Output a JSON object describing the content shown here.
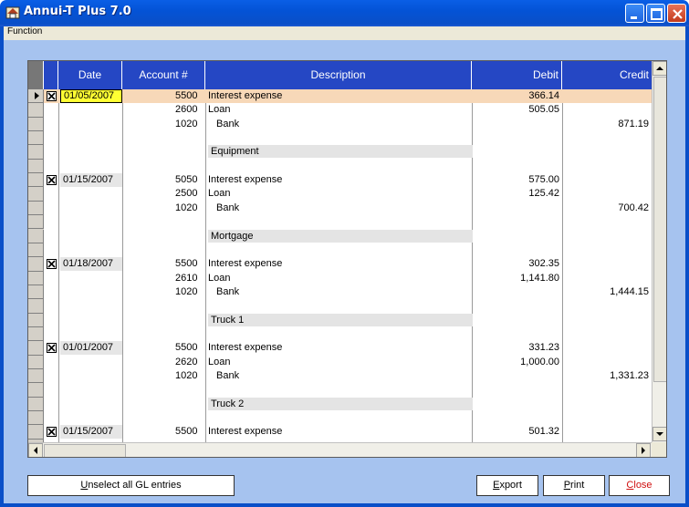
{
  "window": {
    "title": "Annui-T Plus 7.0"
  },
  "menu": {
    "function_label": "Function"
  },
  "columns": {
    "date": "Date",
    "account": "Account #",
    "description": "Description",
    "debit": "Debit",
    "credit": "Credit"
  },
  "rows": [
    {
      "checked": true,
      "date": "01/05/2007",
      "account": "5500",
      "description": "Interest expense",
      "debit": "366.14",
      "credit": "",
      "selected": true
    },
    {
      "account": "2600",
      "description": "Loan",
      "debit": "505.05",
      "credit": ""
    },
    {
      "account": "1020",
      "description": "Bank",
      "indent": true,
      "debit": "",
      "credit": "871.19"
    },
    {},
    {
      "category": "Equipment"
    },
    {},
    {
      "checked": true,
      "date": "01/15/2007",
      "account": "5050",
      "description": "Interest expense",
      "debit": "575.00",
      "credit": ""
    },
    {
      "account": "2500",
      "description": "Loan",
      "debit": "125.42",
      "credit": ""
    },
    {
      "account": "1020",
      "description": "Bank",
      "indent": true,
      "debit": "",
      "credit": "700.42"
    },
    {},
    {
      "category": "Mortgage"
    },
    {},
    {
      "checked": true,
      "date": "01/18/2007",
      "account": "5500",
      "description": "Interest expense",
      "debit": "302.35",
      "credit": ""
    },
    {
      "account": "2610",
      "description": "Loan",
      "debit": "1,141.80",
      "credit": ""
    },
    {
      "account": "1020",
      "description": "Bank",
      "indent": true,
      "debit": "",
      "credit": "1,444.15"
    },
    {},
    {
      "category": "Truck 1"
    },
    {},
    {
      "checked": true,
      "date": "01/01/2007",
      "account": "5500",
      "description": "Interest expense",
      "debit": "331.23",
      "credit": ""
    },
    {
      "account": "2620",
      "description": "Loan",
      "debit": "1,000.00",
      "credit": ""
    },
    {
      "account": "1020",
      "description": "Bank",
      "indent": true,
      "debit": "",
      "credit": "1,331.23"
    },
    {},
    {
      "category": "Truck 2"
    },
    {},
    {
      "checked": true,
      "date": "01/15/2007",
      "account": "5500",
      "description": "Interest expense",
      "debit": "501.32",
      "credit": ""
    }
  ],
  "buttons": {
    "unselect_prefix": "U",
    "unselect_rest": "nselect all GL entries",
    "export_prefix": "E",
    "export_rest": "xport",
    "print_prefix": "P",
    "print_rest": "rint",
    "close_prefix": "C",
    "close_rest": "lose"
  },
  "colors": {
    "titlebar": "#0a5fe6",
    "header": "#2547c4",
    "selected_row": "#f7d8b8",
    "selected_date": "#ffff33",
    "client_bg": "#a6c3ef",
    "close_text": "#d01010"
  }
}
